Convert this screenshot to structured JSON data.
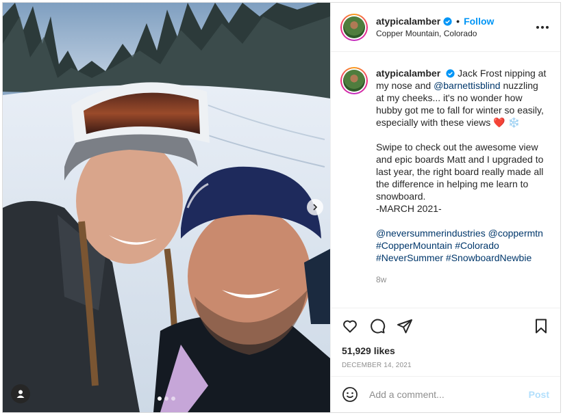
{
  "post": {
    "username": "atypicalamber",
    "follow_label": "Follow",
    "separator": "•",
    "location": "Copper Mountain, Colorado",
    "caption": {
      "p1_text": "Jack Frost nipping at my nose and",
      "p1_mention": "@barnettisblind",
      "p1_rest": "nuzzling at my cheeks... it's no wonder how hubby got me to fall for winter so easily, especially with these views ❤️ ❄️",
      "p2_text": "Swipe to check out the awesome view and epic boards Matt and I upgraded to last year, the right board really made all the difference in helping me learn to snowboard.",
      "p2_date": "-MARCH 2021-",
      "p3_mention1": "@neversummerindustries",
      "p3_mention2": "@coppermtn",
      "p3_tag1": "#CopperMountain",
      "p3_tag2": "#Colorado",
      "p3_tag3": "#NeverSummer",
      "p3_tag4": "#SnowboardNewbie"
    },
    "age": "8w",
    "likes": "51,929 likes",
    "date": "DECEMBER 14, 2021",
    "comment_placeholder": "Add a comment...",
    "post_label": "Post",
    "carousel": {
      "count": 3,
      "active": 0
    },
    "colors": {
      "accent": "#0095f6",
      "mention": "#00376b",
      "muted": "#8e8e8e",
      "post_disabled": "#b2dffc"
    },
    "icons": [
      "verified-badge-icon",
      "more-options-icon",
      "heart-icon",
      "comment-icon",
      "share-icon",
      "save-icon",
      "emoji-icon",
      "user-tag-icon",
      "chevron-right-icon"
    ]
  }
}
